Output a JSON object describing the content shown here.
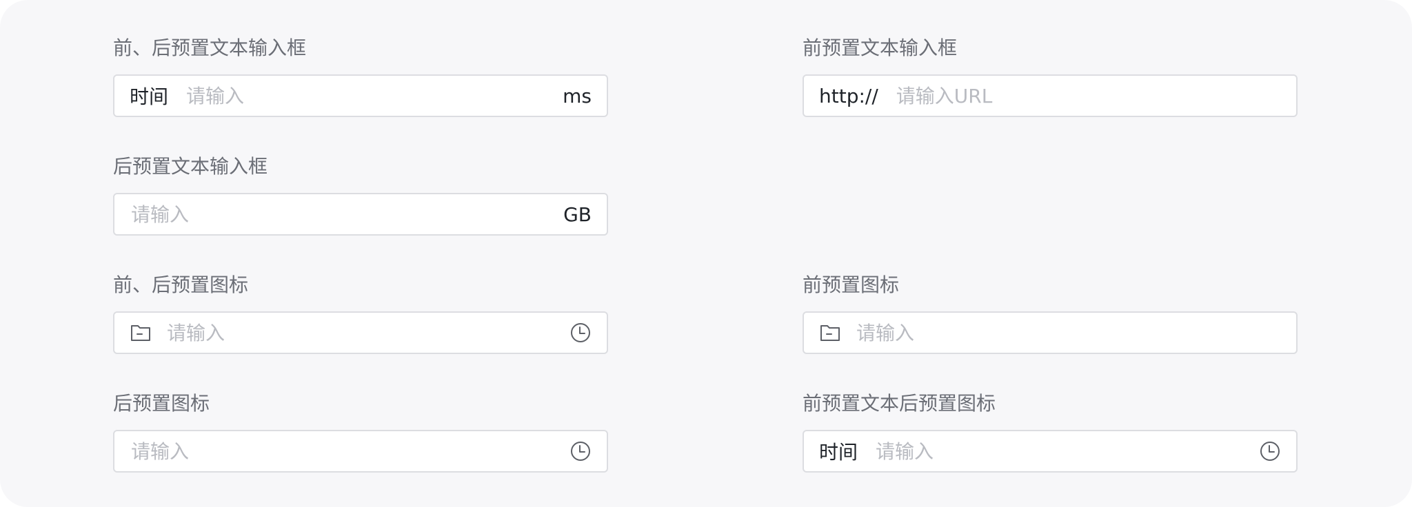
{
  "fields": {
    "prefix_suffix_text": {
      "label": "前、后预置文本输入框",
      "prefix": "时间",
      "placeholder": "请输入",
      "suffix": "ms"
    },
    "prefix_text": {
      "label": "前预置文本输入框",
      "prefix": "http://",
      "placeholder": "请输入URL"
    },
    "suffix_text": {
      "label": "后预置文本输入框",
      "placeholder": "请输入",
      "suffix": "GB"
    },
    "prefix_suffix_icon": {
      "label": "前、后预置图标",
      "prefix_icon": "folder-icon",
      "placeholder": "请输入",
      "suffix_icon": "clock-icon"
    },
    "prefix_icon": {
      "label": "前预置图标",
      "prefix_icon": "folder-icon",
      "placeholder": "请输入"
    },
    "suffix_icon": {
      "label": "后预置图标",
      "placeholder": "请输入",
      "suffix_icon": "clock-icon"
    },
    "prefix_text_suffix_icon": {
      "label": "前预置文本后预置图标",
      "prefix": "时间",
      "placeholder": "请输入",
      "suffix_icon": "clock-icon"
    }
  },
  "colors": {
    "background": "#f7f7f9",
    "input_border": "#dcdde1",
    "label_text": "#6b6e76",
    "value_text": "#1f2329",
    "placeholder_text": "#b9bbc1",
    "icon_stroke": "#5c5f66"
  }
}
